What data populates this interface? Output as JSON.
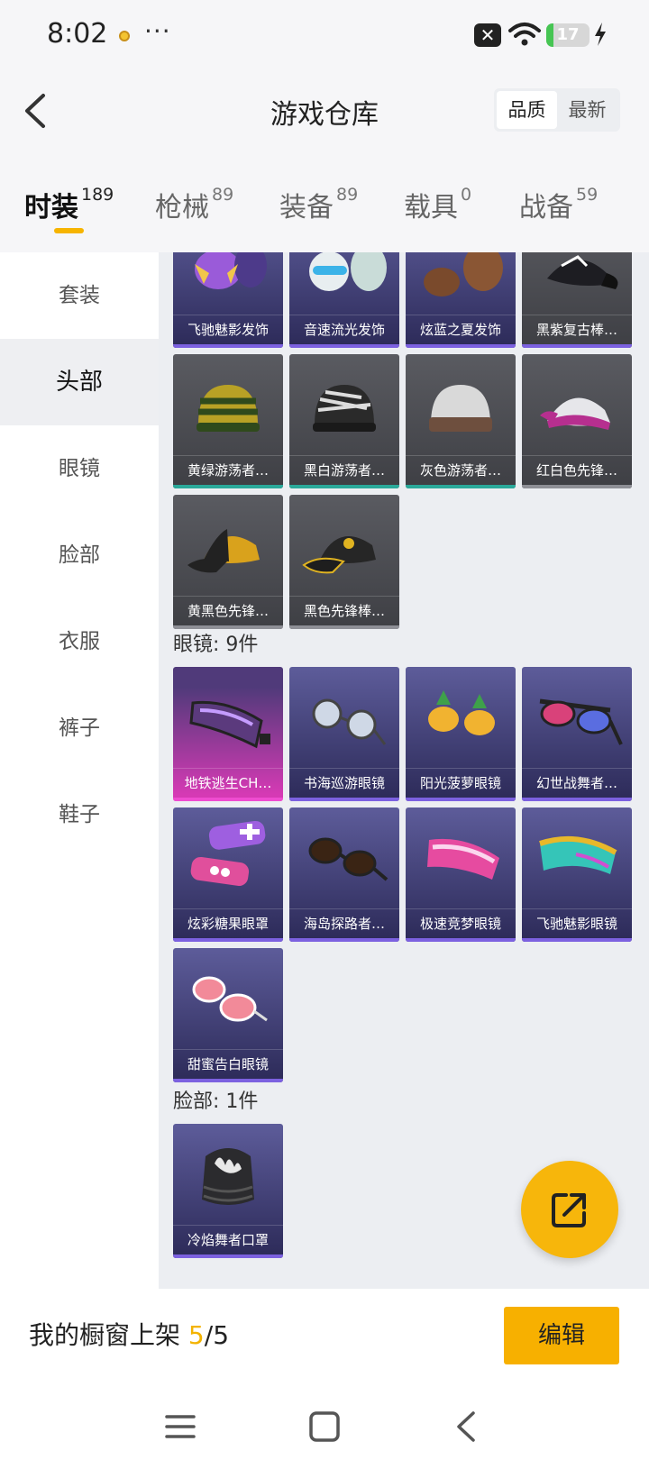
{
  "status_bar": {
    "time": "8:02",
    "more": "···",
    "sim_icon": "sim-off-icon",
    "battery_level": "17",
    "battery_fraction": 0.17
  },
  "header": {
    "title": "游戏仓库",
    "back_icon": "chevron-left-icon",
    "sort_options": [
      "品质",
      "最新"
    ],
    "selected_sort": "品质"
  },
  "category_tabs": [
    {
      "label": "时装",
      "count": "189"
    },
    {
      "label": "枪械",
      "count": "89"
    },
    {
      "label": "装备",
      "count": "89"
    },
    {
      "label": "载具",
      "count": "0"
    },
    {
      "label": "战备",
      "count": "59"
    }
  ],
  "active_tab": "时装",
  "sidebar": {
    "items": [
      "套装",
      "头部",
      "眼镜",
      "脸部",
      "衣服",
      "裤子",
      "鞋子"
    ],
    "active": "头部"
  },
  "head_items": [
    {
      "name": "飞驰魅影发饰",
      "rarity": "purple"
    },
    {
      "name": "音速流光发饰",
      "rarity": "purple"
    },
    {
      "name": "炫蓝之夏发饰",
      "rarity": "purple"
    },
    {
      "name": "黑紫复古棒…",
      "rarity": "purple"
    },
    {
      "name": "黄绿游荡者…",
      "rarity": "teal"
    },
    {
      "name": "黑白游荡者…",
      "rarity": "teal"
    },
    {
      "name": "灰色游荡者…",
      "rarity": "teal"
    },
    {
      "name": "红白色先锋…",
      "rarity": "grey"
    },
    {
      "name": "黄黑色先锋…",
      "rarity": "grey"
    },
    {
      "name": "黑色先锋棒…",
      "rarity": "grey"
    }
  ],
  "glasses_section": {
    "label": "眼镜: 9件"
  },
  "glasses_items": [
    {
      "name": "地铁逃生CH…",
      "rarity": "pink"
    },
    {
      "name": "书海巡游眼镜",
      "rarity": "purple"
    },
    {
      "name": "阳光菠萝眼镜",
      "rarity": "purple"
    },
    {
      "name": "幻世战舞者…",
      "rarity": "purple"
    },
    {
      "name": "炫彩糖果眼罩",
      "rarity": "purple"
    },
    {
      "name": "海岛探路者…",
      "rarity": "purple"
    },
    {
      "name": "极速竞梦眼镜",
      "rarity": "purple"
    },
    {
      "name": "飞驰魅影眼镜",
      "rarity": "purple"
    },
    {
      "name": "甜蜜告白眼镜",
      "rarity": "purple"
    }
  ],
  "face_section": {
    "label": "脸部: 1件"
  },
  "face_items": [
    {
      "name": "冷焰舞者口罩",
      "rarity": "purple"
    }
  ],
  "fab": {
    "icon": "share-external-icon"
  },
  "showcase": {
    "label": "我的橱窗上架",
    "current": "5",
    "separator": "/",
    "total": "5"
  },
  "edit_button": "编辑",
  "nav_bar": {
    "menu_icon": "menu-icon",
    "home_icon": "home-square-icon",
    "back_icon": "back-chevron-icon"
  },
  "colors": {
    "accent": "#f7b000",
    "rarity_purple": "#7c61e0",
    "rarity_teal": "#2aa99a",
    "rarity_grey": "#8e8f96",
    "rarity_pink": "#ef4cd0"
  }
}
